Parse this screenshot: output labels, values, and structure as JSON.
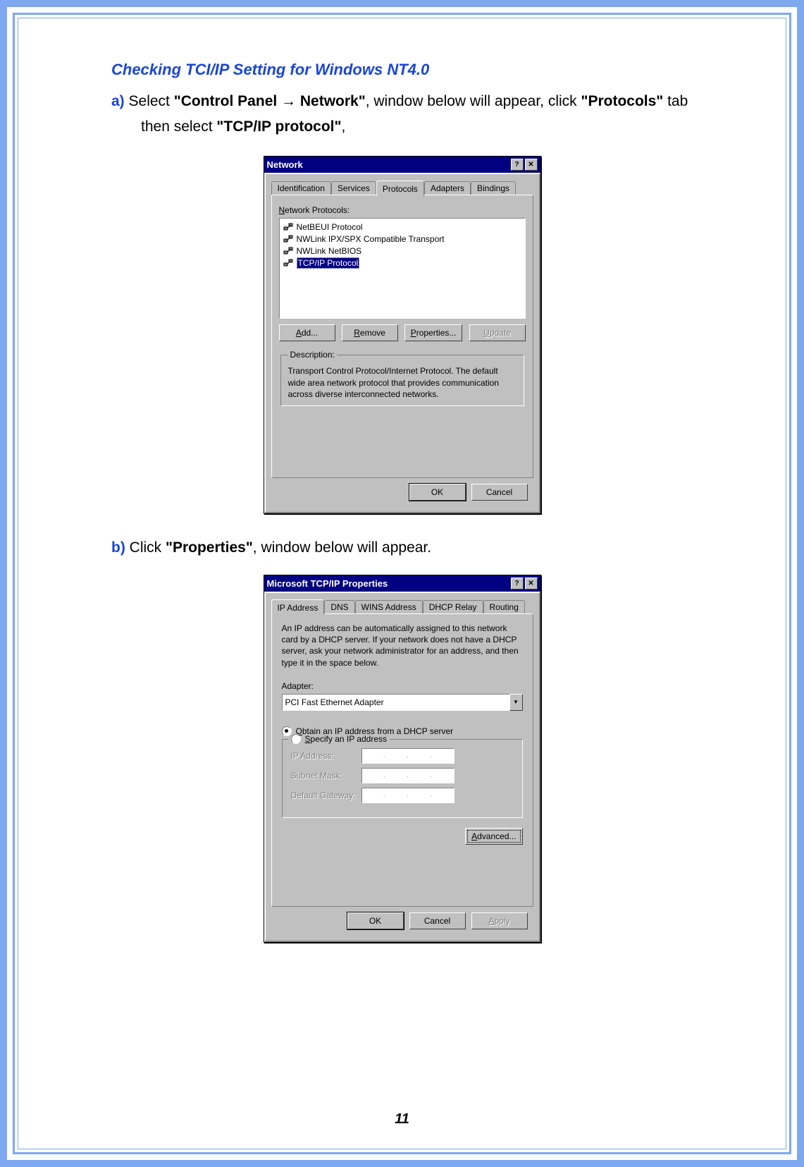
{
  "heading": "Checking TCI/IP Setting for Windows NT4.0",
  "step_a": {
    "letter": "a)",
    "t1": " Select ",
    "bold1": "\"Control Panel → Network\"",
    "t2": ", window below will appear, click ",
    "bold2": "\"Protocols\"",
    "t3": " tab",
    "t4": "then select ",
    "bold3": "\"TCP/IP protocol\"",
    "t5": ","
  },
  "step_b": {
    "letter": "b)",
    "t1": " Click ",
    "bold1": "\"Properties\"",
    "t2": ", window below will appear."
  },
  "dlg1": {
    "title": "Network",
    "tabs": [
      "Identification",
      "Services",
      "Protocols",
      "Adapters",
      "Bindings"
    ],
    "active_tab": "Protocols",
    "listbox_label": "Network Protocols:",
    "protocols": [
      "NetBEUI Protocol",
      "NWLink IPX/SPX Compatible Transport",
      "NWLink NetBIOS",
      "TCP/IP Protocol"
    ],
    "selected": 3,
    "buttons": {
      "add": "Add...",
      "remove": "Remove",
      "properties": "Properties...",
      "update": "Update"
    },
    "desc_legend": "Description:",
    "desc_text": "Transport Control Protocol/Internet Protocol. The default wide area network protocol that provides communication across diverse interconnected networks.",
    "ok": "OK",
    "cancel": "Cancel"
  },
  "dlg2": {
    "title": "Microsoft TCP/IP Properties",
    "tabs": [
      "IP Address",
      "DNS",
      "WINS Address",
      "DHCP Relay",
      "Routing"
    ],
    "active_tab": "IP Address",
    "body_text": "An IP address can be automatically assigned to this network card by a DHCP server.  If your network does not have a DHCP server, ask your network administrator for an address, and then type it in the space below.",
    "adapter_label": "Adapter:",
    "adapter_value": "PCI Fast Ethernet Adapter",
    "radio1": "Obtain an IP address from a DHCP server",
    "radio2": "Specify an IP address",
    "ip_label": "IP Address:",
    "mask_label": "Subnet Mask:",
    "gw_label": "Default Gateway:",
    "advanced": "Advanced...",
    "ok": "OK",
    "cancel": "Cancel",
    "apply": "Apply"
  },
  "page_number": "11"
}
